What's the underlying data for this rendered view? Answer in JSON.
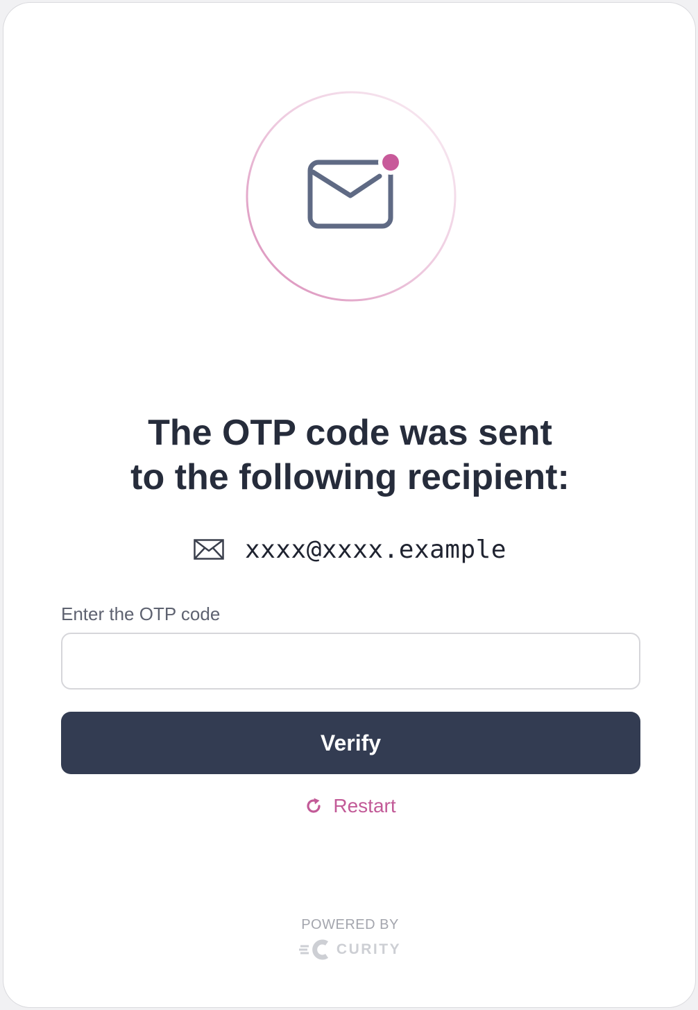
{
  "hero": {
    "icon": "envelope-notification-icon"
  },
  "heading": {
    "line1": "The OTP code was sent",
    "line2": "to the following recipient:"
  },
  "recipient": {
    "icon": "envelope-icon",
    "address": "xxxx@xxxx.example"
  },
  "form": {
    "label": "Enter the OTP code",
    "input_value": "",
    "input_placeholder": "",
    "verify_label": "Verify"
  },
  "restart": {
    "icon": "restart-icon",
    "label": "Restart"
  },
  "footer": {
    "powered_by": "POWERED BY",
    "brand_name": "CURITY",
    "brand_icon": "curity-logo-icon"
  },
  "colors": {
    "primary_button": "#333c52",
    "accent": "#c25a97",
    "heading_text": "#262c3b",
    "card_background": "#ffffff",
    "page_background": "#f1f1f3"
  }
}
